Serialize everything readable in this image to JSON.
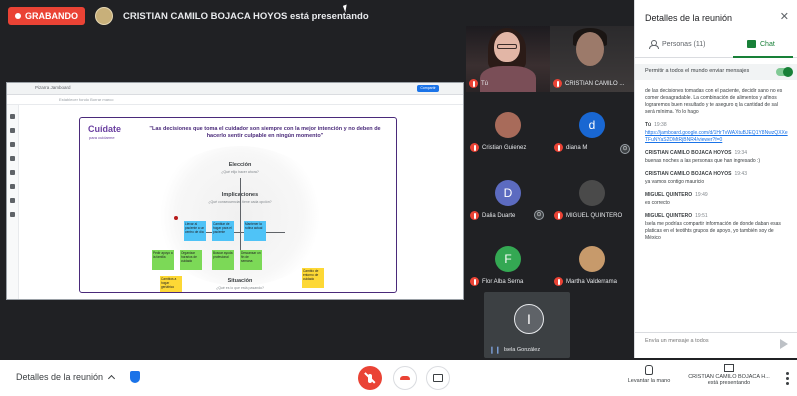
{
  "recording": {
    "label": "GRABANDO"
  },
  "presenter_banner": {
    "text": "CRISTIAN CAMILO BOJACA HOYOS está presentando"
  },
  "slide": {
    "app_name": "Pizarra Jamboard",
    "share_label": "Compartir",
    "toolbar_hint": "Establecer fondo   Borrar marco",
    "logo": "Cuídate",
    "logo_sub": "para cuidarme",
    "headline": "\"Las decisiones que toma el cuidador son siempre con la mejor intención y no deben de hacerlo sentir culpable en ningún momento\"",
    "sections": [
      {
        "title": "Elección",
        "desc": "¿Qué elijo hacer ahora?"
      },
      {
        "title": "Implicaciones",
        "desc": "¿Qué consecuencias tiene cada opción?"
      },
      {
        "title": "Situación",
        "desc": "¿Qué es lo que está pasando?"
      }
    ],
    "stickies": {
      "blue": [
        "Llevar al paciente a un centro de día",
        "Cambiar de hogar para el paciente",
        "Mantener la rutina actual"
      ],
      "green": [
        "Pedir apoyo a la familia",
        "Organizar horarios de cuidado",
        "Buscar ayuda profesional",
        "Descansar un fin de semana"
      ],
      "yellow": [
        "Cambios a hogar geriátrico",
        "Cambio de entorno de cuidado"
      ]
    }
  },
  "participants": {
    "cam1": {
      "name": "Tú"
    },
    "cam2": {
      "name": "CRISTIAN CAMILO ..."
    },
    "tiles": [
      {
        "name": "Cristian Guienez",
        "initial": "",
        "color": "#a86b5a"
      },
      {
        "name": "diana M",
        "initial": "d",
        "color": "#1967d2"
      },
      {
        "name": "Dalia Duarte",
        "initial": "D",
        "color": "#5c6bc0"
      },
      {
        "name": "MIGUEL QUINTERO",
        "initial": "",
        "color": "#4a4a4a"
      },
      {
        "name": "Flor Alba Serna",
        "initial": "F",
        "color": "#34a853"
      },
      {
        "name": "Martha Valderrama",
        "initial": "",
        "color": "#c79a6b"
      }
    ],
    "active": {
      "name": "Isela González",
      "initial": "I"
    }
  },
  "panel": {
    "title": "Detalles de la reunión",
    "tab_people": "Personas (11)",
    "tab_chat": "Chat",
    "setting": "Permitir a todos el mundo enviar mensajes",
    "messages": [
      {
        "sender": "",
        "time": "",
        "text": "de las decisiones tomadas con el paciente, decidir sano no es comer desagradable. La combinación de alimentos y afinos lograremos buen resultado y te aseguro q la cantidad de sal será mínima. Yo lo hago",
        "link": ""
      },
      {
        "sender": "Tú",
        "time": "19:38",
        "text": "",
        "link": "https://jamboard.google.com/d/1HrTvWAXtuBJEQ1Y8NwzQXXeTFuNYaS2DMtRjBNR4/viewer?f=0"
      },
      {
        "sender": "CRISTIAN CAMILO BOJACA HOYOS",
        "time": "19:34",
        "text": "buenas noches a las personas que han ingresado :)",
        "link": ""
      },
      {
        "sender": "CRISTIAN CAMILO BOJACA HOYOS",
        "time": "19:43",
        "text": "ya vamos contigo mauricio",
        "link": ""
      },
      {
        "sender": "MIGUEL QUINTERO",
        "time": "19:49",
        "text": "es correcto",
        "link": ""
      },
      {
        "sender": "MIGUEL QUINTERO",
        "time": "19:51",
        "text": "Isela me podrías compartir información de donde daban esas platicas en el teotihts grupos de apoyo, yo también soy de México",
        "link": ""
      }
    ],
    "input_placeholder": "Envía un mensaje a todos"
  },
  "bottom": {
    "details_label": "Detalles de la reunión",
    "raise_hand": "Levantar la mano",
    "presenting_name": "CRISTIAN CAMILO BOJACA H...",
    "presenting_sub": "está presentando"
  },
  "colors": {
    "accent": "#188038",
    "record": "#ea4335",
    "link": "#1a73e8"
  }
}
